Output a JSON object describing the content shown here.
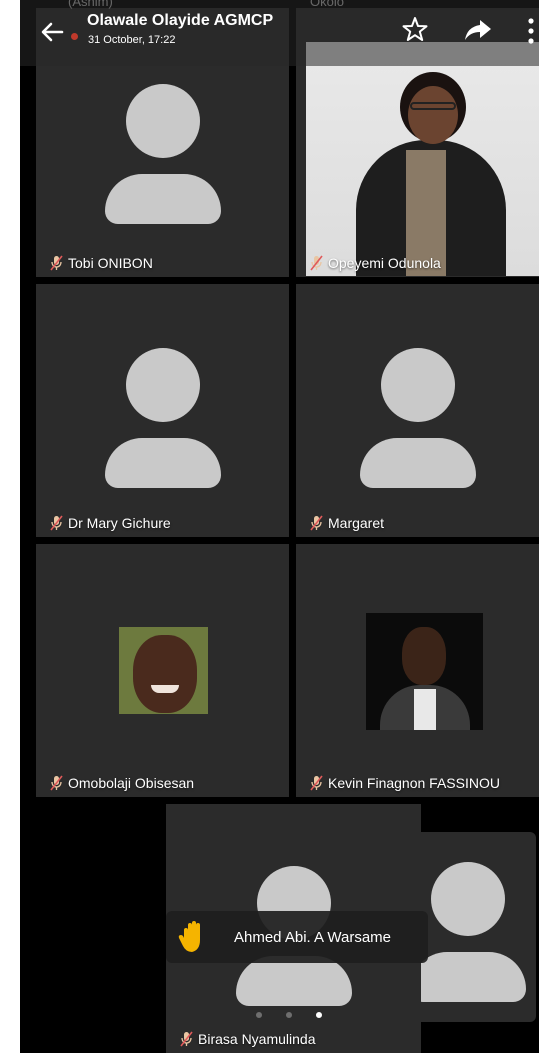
{
  "header": {
    "title": "Olawale Olayide AGMCP",
    "subtitle": "31 October, 17:22",
    "ghost_left": "(Ashim)",
    "ghost_right": "Okolo"
  },
  "participants": [
    {
      "name": "Tobi ONIBON",
      "muted": true,
      "video": false
    },
    {
      "name": "Opeyemi Odunola",
      "muted": true,
      "video": true
    },
    {
      "name": "Dr Mary Gichure",
      "muted": true,
      "video": false
    },
    {
      "name": "Margaret",
      "muted": true,
      "video": false
    },
    {
      "name": "Omobolaji Obisesan",
      "muted": true,
      "video": true
    },
    {
      "name": "Kevin Finagnon FASSINOU",
      "muted": true,
      "video": true
    },
    {
      "name": "Birasa Nyamulinda",
      "muted": true,
      "video": false
    }
  ],
  "raised_hand": {
    "name": "Ahmed Abi. A Warsame",
    "icon": "raised-hand-icon"
  },
  "pager": {
    "pages": 3,
    "current": 3
  },
  "colors": {
    "tile": "#2b2b2b",
    "avatar": "#c9c9c9",
    "background": "#000000",
    "hand": "#f5b400"
  }
}
